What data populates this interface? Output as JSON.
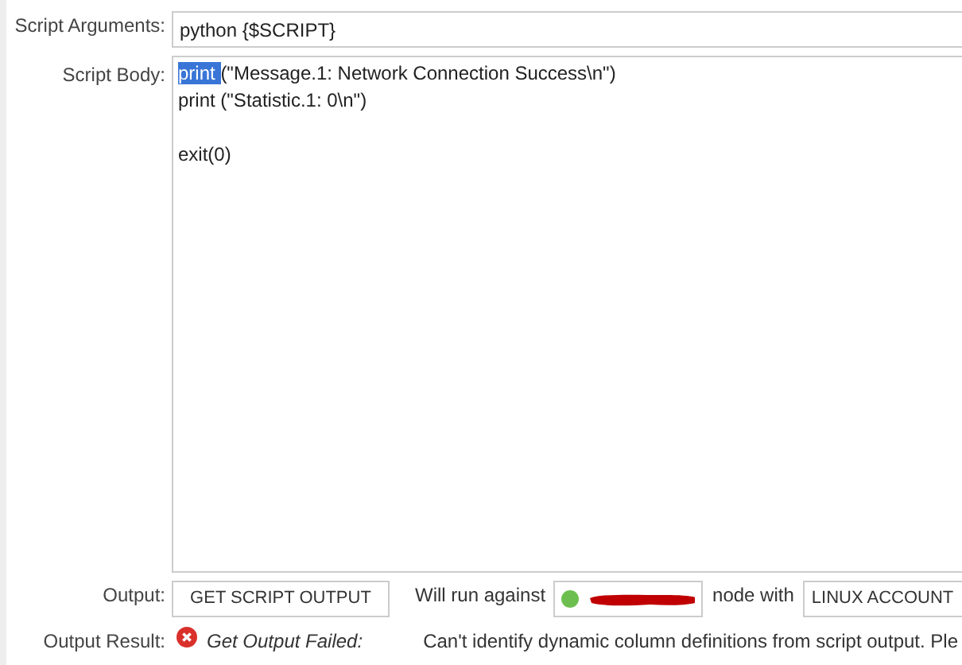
{
  "script_arguments": {
    "label": "Script Arguments:",
    "value": "python {$SCRIPT}"
  },
  "script_body": {
    "label": "Script Body:",
    "lines": [
      {
        "kind": "code",
        "selected_text": "print ",
        "text": "(\"Message.1: Network Connection Success\\n\")"
      },
      {
        "kind": "code",
        "text": "print (\"Statistic.1: 0\\n\")"
      },
      {
        "kind": "blank"
      },
      {
        "kind": "code",
        "text": "exit(0)"
      }
    ]
  },
  "output": {
    "label": "Output:",
    "button": "GET SCRIPT OUTPUT",
    "run_text": "Will run against",
    "node": {
      "color": "#6cbf4e",
      "redacted": true
    },
    "node_text": "node with",
    "account": "LINUX ACCOUNT"
  },
  "output_result": {
    "label": "Output Result:",
    "kind": "error",
    "status_text": "Get Output Failed:",
    "message": "Can't identify dynamic column definitions from script output. Ple"
  }
}
